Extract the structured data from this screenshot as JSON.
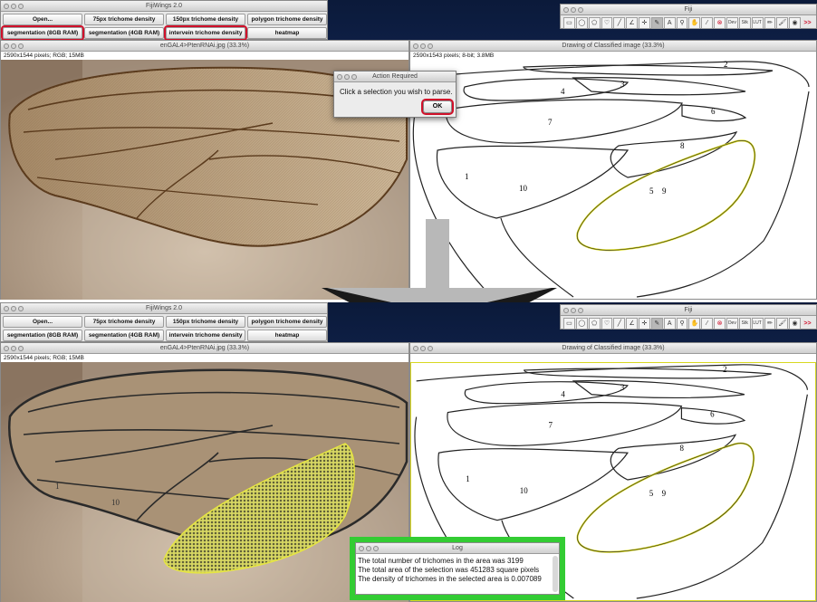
{
  "fijiwings": {
    "title": "FijiWings 2.0",
    "buttons": [
      "Open...",
      "75px trichome density",
      "150px trichome density",
      "polygon trichome density",
      "segmentation (8GB RAM)",
      "segmentation (4GB RAM)",
      "intervein trichome density",
      "heatmap"
    ]
  },
  "fiji": {
    "title": "Fiji",
    "tools": [
      "rectangle-icon",
      "oval-icon",
      "polygon-icon",
      "freehand-icon",
      "line-icon",
      "angle-icon",
      "point-icon",
      "wand-icon",
      "text-tool",
      "magnifier-icon",
      "hand-icon",
      "dropper-icon",
      "close-red-icon",
      "dev-tool",
      "stk-tool",
      "lut-tool",
      "pencil-icon",
      "brush-icon",
      "flood-icon",
      "more-icon"
    ],
    "tool_labels": {
      "text": "A",
      "dev": "Dev",
      "stk": "Stk",
      "lut": "LUT",
      "more": ">>"
    }
  },
  "wing_window": {
    "title": "enGAL4>PtenRNAi.jpg (33.3%)",
    "info": "2590x1544 pixels; RGB; 15MB"
  },
  "classified_window": {
    "title": "Drawing of Classified image (33.3%)",
    "info": "2590x1543 pixels; 8-bit; 3.8MB",
    "region_labels": [
      "2",
      "3",
      "4",
      "6",
      "7",
      "8",
      "1",
      "10",
      "5",
      "9"
    ]
  },
  "bottom_wing_labels": [
    "1",
    "10"
  ],
  "action_dialog": {
    "title": "Action Required",
    "message": "Click a selection you wish to parse.",
    "ok_label": "OK"
  },
  "log_window": {
    "title": "Log",
    "lines": [
      "The total number of trichomes in the area was 3199",
      "The total area of the selection was 451283 square pixels",
      "The density of trichomes in the selected area is 0.007089"
    ]
  },
  "colors": {
    "highlight_red": "#d0102a",
    "highlight_green": "#33cc33",
    "selection_yellow": "#d8d820",
    "arrow_gray": "#b8b8b8"
  }
}
